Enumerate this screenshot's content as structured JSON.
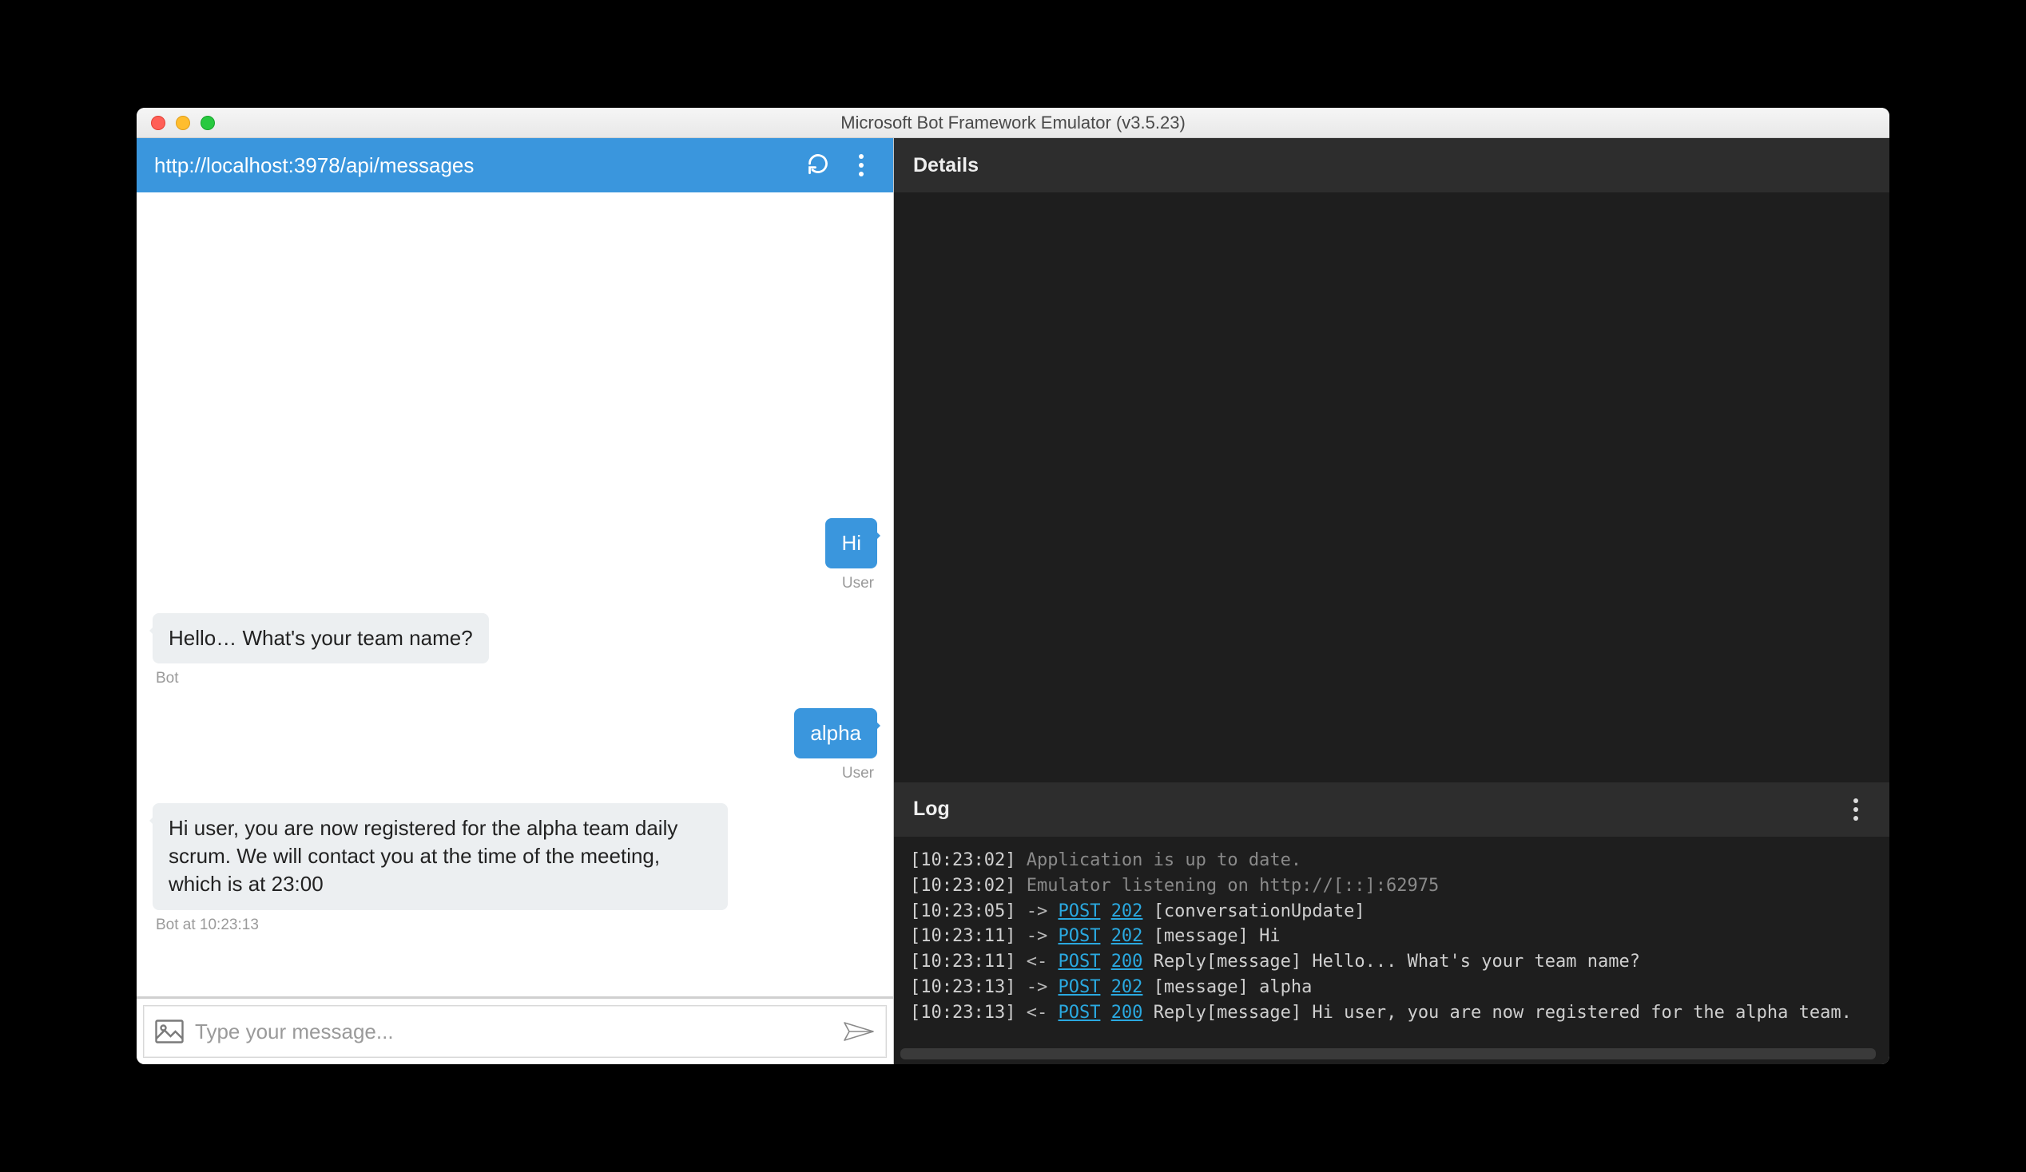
{
  "window": {
    "title": "Microsoft Bot Framework Emulator (v3.5.23)"
  },
  "urlbar": {
    "url": "http://localhost:3978/api/messages"
  },
  "chat": {
    "messages": [
      {
        "side": "user",
        "text": "Hi",
        "meta": "User"
      },
      {
        "side": "bot",
        "text": "Hello… What's your team name?",
        "meta": "Bot"
      },
      {
        "side": "user",
        "text": "alpha",
        "meta": "User"
      },
      {
        "side": "bot",
        "text": "Hi user, you are now registered for the alpha team daily scrum. We will contact you at the time of the meeting, which is at 23:00",
        "meta": "Bot at 10:23:13"
      }
    ],
    "input_placeholder": "Type your message..."
  },
  "details": {
    "title": "Details"
  },
  "log": {
    "title": "Log",
    "lines": [
      {
        "ts": "[10:23:02]",
        "dim": true,
        "rest": "Application is up to date."
      },
      {
        "ts": "[10:23:02]",
        "dim": true,
        "rest": "Emulator listening on http://[::]:62975"
      },
      {
        "ts": "[10:23:05]",
        "arrow": "->",
        "method": "POST",
        "status": "202",
        "rest": "[conversationUpdate]"
      },
      {
        "ts": "[10:23:11]",
        "arrow": "->",
        "method": "POST",
        "status": "202",
        "rest": "[message] Hi"
      },
      {
        "ts": "[10:23:11]",
        "arrow": "<-",
        "method": "POST",
        "status": "200",
        "rest": "Reply[message] Hello... What's your team name?"
      },
      {
        "ts": "[10:23:13]",
        "arrow": "->",
        "method": "POST",
        "status": "202",
        "rest": "[message] alpha"
      },
      {
        "ts": "[10:23:13]",
        "arrow": "<-",
        "method": "POST",
        "status": "200",
        "rest": "Reply[message] Hi user, you are now registered for the alpha team."
      }
    ]
  }
}
